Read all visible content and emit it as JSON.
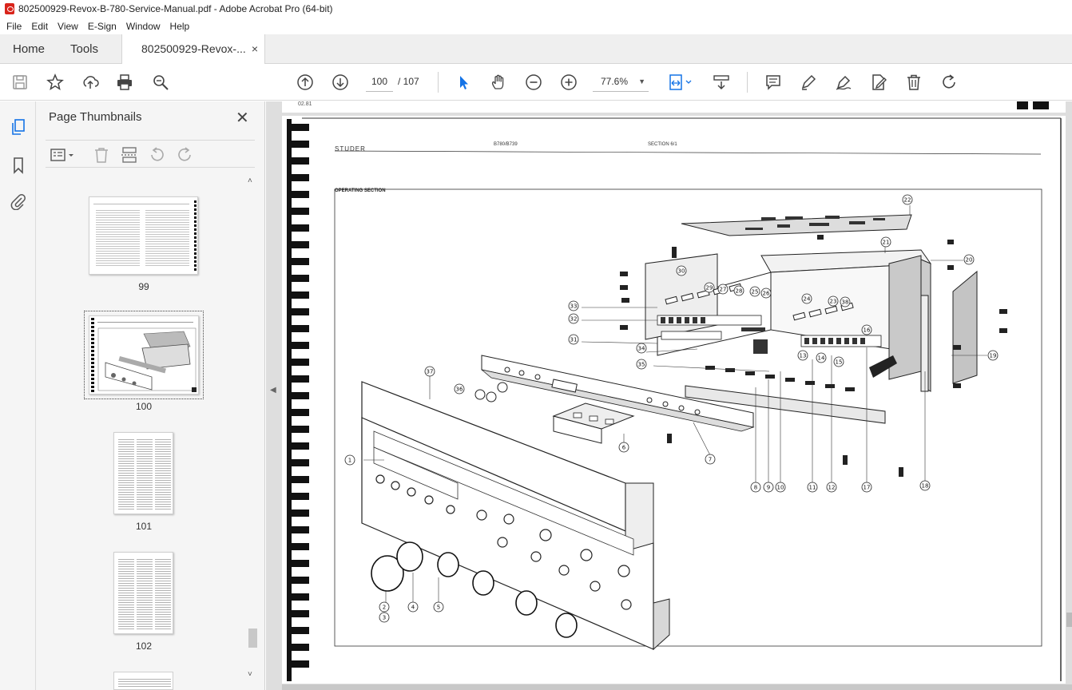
{
  "window": {
    "title": "802500929-Revox-B-780-Service-Manual.pdf - Adobe Acrobat Pro (64-bit)"
  },
  "menu": [
    "File",
    "Edit",
    "View",
    "E-Sign",
    "Window",
    "Help"
  ],
  "tabs": {
    "home": "Home",
    "tools": "Tools",
    "document": "802500929-Revox-...",
    "close": "×"
  },
  "toolbar": {
    "icons": [
      "save-icon",
      "star-icon",
      "upload-icon",
      "print-icon",
      "zoom-search-icon",
      "prev-page-icon",
      "next-page-icon",
      "select-cursor-icon",
      "hand-icon",
      "zoom-out-icon",
      "zoom-in-icon",
      "fit-page-icon",
      "scroll-mode-icon",
      "comment-icon",
      "highlight-icon",
      "sign-icon",
      "edit-pdf-icon",
      "delete-icon",
      "rotate-icon"
    ],
    "page_current": "100",
    "page_total": "/ 107",
    "zoom": "77.6%"
  },
  "sidebar_panel": {
    "title": "Page Thumbnails",
    "close": "✕",
    "thumbnails": [
      {
        "label": "99"
      },
      {
        "label": "100",
        "selected": true
      },
      {
        "label": "101"
      },
      {
        "label": "102"
      }
    ]
  },
  "document": {
    "prev_page_number": "02.81",
    "brand": "STUDER",
    "model": "B780/B739",
    "section": "SECTION 6/1",
    "figure_title": "OPERATING SECTION",
    "callouts": [
      "1",
      "2",
      "3",
      "4",
      "5",
      "6",
      "7",
      "8",
      "9",
      "10",
      "11",
      "12",
      "13",
      "14",
      "15",
      "16",
      "17",
      "18",
      "19",
      "20",
      "21",
      "22",
      "23",
      "24",
      "25",
      "26",
      "27",
      "28",
      "29",
      "30",
      "31",
      "32",
      "33",
      "34",
      "35",
      "36",
      "37",
      "38"
    ]
  }
}
